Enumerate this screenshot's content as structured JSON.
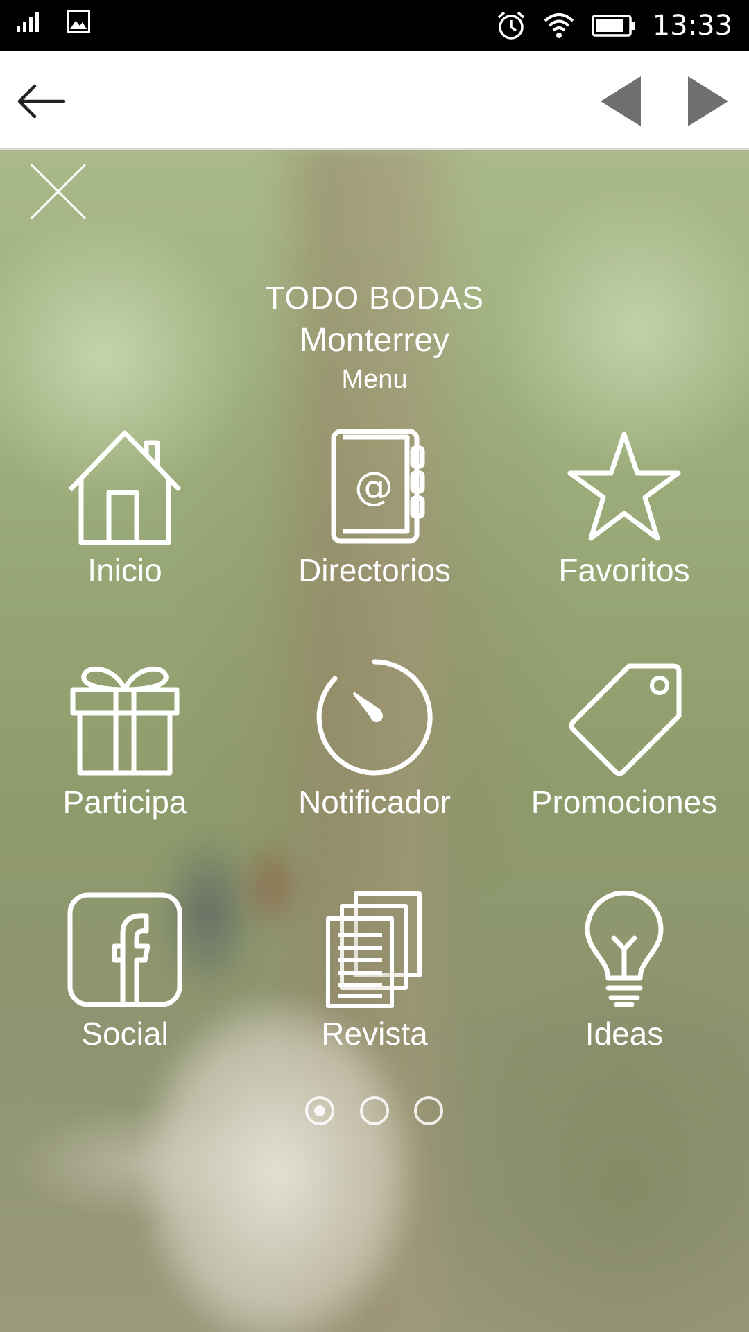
{
  "status_bar": {
    "time": "13:33",
    "icons": [
      "signal-icon",
      "image-icon",
      "alarm-icon",
      "wifi-icon",
      "battery-icon"
    ]
  },
  "toolbar": {
    "icons": [
      "back-arrow-icon",
      "previous-icon",
      "next-icon"
    ]
  },
  "menu": {
    "title_line1": "TODO BODAS",
    "title_line2": "Monterrey",
    "title_line3": "Menu",
    "items": [
      {
        "label": "Inicio",
        "icon": "home-icon"
      },
      {
        "label": "Directorios",
        "icon": "address-book-icon"
      },
      {
        "label": "Favoritos",
        "icon": "star-icon"
      },
      {
        "label": "Participa",
        "icon": "gift-icon"
      },
      {
        "label": "Notificador",
        "icon": "timer-icon"
      },
      {
        "label": "Promociones",
        "icon": "tag-icon"
      },
      {
        "label": "Social",
        "icon": "facebook-icon"
      },
      {
        "label": "Revista",
        "icon": "documents-icon"
      },
      {
        "label": "Ideas",
        "icon": "lightbulb-icon"
      }
    ],
    "pager": {
      "pages": 3,
      "current": 1
    }
  },
  "colors": {
    "status_bar_bg": "#000000",
    "toolbar_bg": "#ffffff",
    "toolbar_icon": "#6f6f6f",
    "overlay_text": "#ffffff"
  }
}
